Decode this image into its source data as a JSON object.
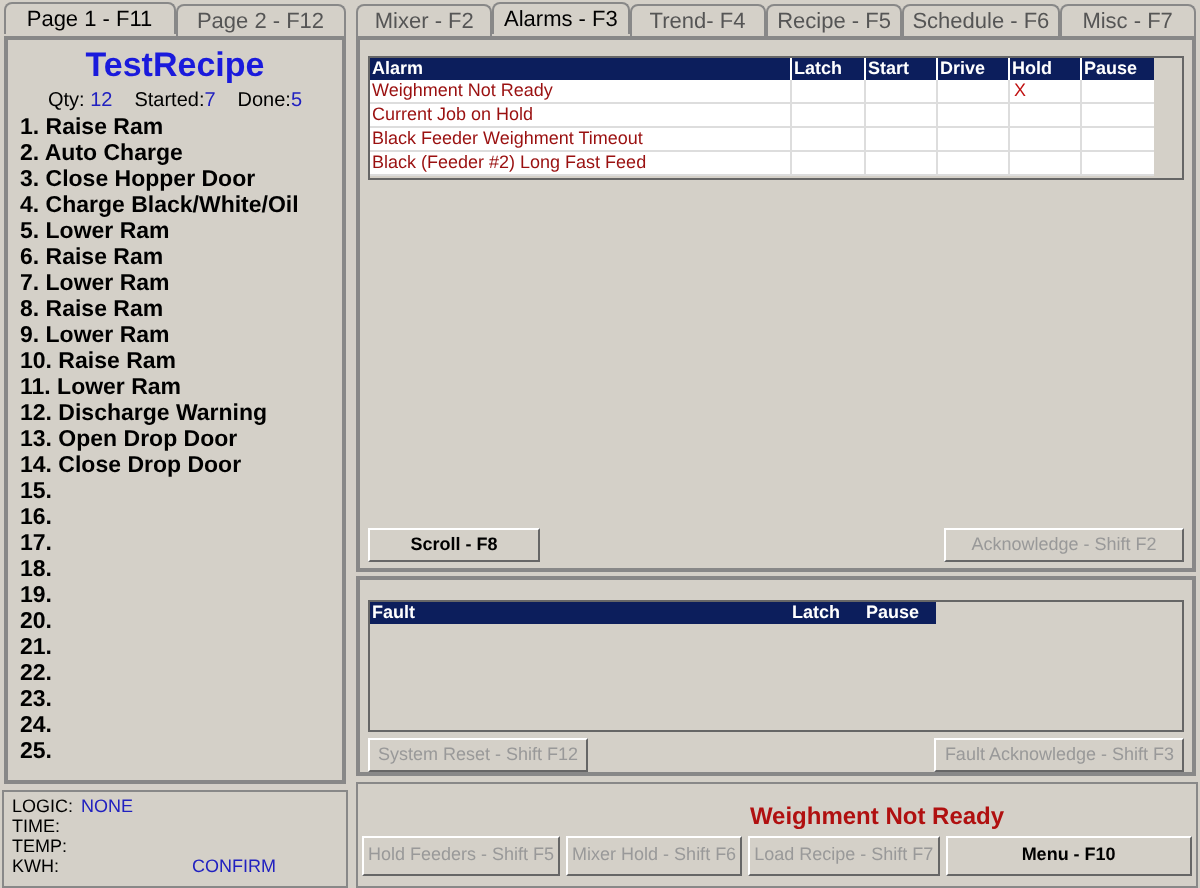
{
  "left_tabs": [
    {
      "label": "Page 1 - F11",
      "selected": true
    },
    {
      "label": "Page 2 - F12",
      "selected": false
    }
  ],
  "recipe": {
    "title": "TestRecipe",
    "qty_label": "Qty:",
    "qty": "12",
    "started_label": "Started:",
    "started": "7",
    "done_label": "Done:",
    "done": "5"
  },
  "steps": [
    "1. Raise Ram",
    "2. Auto Charge",
    "3. Close Hopper Door",
    "4. Charge Black/White/Oil",
    "5. Lower Ram",
    "6. Raise Ram",
    "7. Lower Ram",
    "8. Raise Ram",
    "9. Lower Ram",
    "10. Raise Ram",
    "11. Lower Ram",
    "12. Discharge Warning",
    "13. Open Drop Door",
    "14. Close Drop Door",
    "15.",
    "16.",
    "17.",
    "18.",
    "19.",
    "20.",
    "21.",
    "22.",
    "23.",
    "24.",
    "25."
  ],
  "status": {
    "logic_label": "LOGIC:",
    "logic": "NONE",
    "time_label": "TIME:",
    "temp_label": "TEMP:",
    "kwh_label": "KWH:",
    "confirm": "CONFIRM"
  },
  "right_tabs": [
    {
      "label": "Mixer - F2",
      "selected": false
    },
    {
      "label": "Alarms - F3",
      "selected": true
    },
    {
      "label": "Trend- F4",
      "selected": false
    },
    {
      "label": "Recipe - F5",
      "selected": false
    },
    {
      "label": "Schedule - F6",
      "selected": false
    },
    {
      "label": "Misc - F7",
      "selected": false
    }
  ],
  "alarm_table": {
    "columns": [
      "Alarm",
      "Latch",
      "Start",
      "Drive",
      "Hold",
      "Pause"
    ],
    "mark": "X",
    "rows": [
      {
        "alarm": "Weighment Not Ready",
        "flags": [
          false,
          false,
          false,
          true,
          false
        ]
      },
      {
        "alarm": "Current Job on Hold",
        "flags": [
          false,
          false,
          false,
          false,
          false
        ]
      },
      {
        "alarm": "Black Feeder Weighment Timeout",
        "flags": [
          false,
          false,
          false,
          false,
          false
        ]
      },
      {
        "alarm": "Black  (Feeder #2) Long Fast Feed",
        "flags": [
          false,
          false,
          false,
          false,
          false
        ]
      }
    ]
  },
  "alarm_buttons": [
    {
      "label": "Scroll - F8",
      "disabled": false
    },
    {
      "label": "Acknowledge - Shift F2",
      "disabled": true
    }
  ],
  "fault_table": {
    "columns": [
      "Fault",
      "Latch",
      "Pause"
    ]
  },
  "fault_buttons": [
    {
      "label": "System Reset - Shift F12",
      "disabled": true
    },
    {
      "label": "Fault Acknowledge - Shift F3",
      "disabled": true
    }
  ],
  "message": "Weighment Not Ready",
  "bottom_buttons": [
    {
      "label": "Hold Feeders - Shift F5",
      "disabled": true
    },
    {
      "label": "Mixer Hold -   Shift F6",
      "disabled": true
    },
    {
      "label": "Load Recipe - Shift F7",
      "disabled": true
    },
    {
      "label": "Menu - F10",
      "disabled": false
    }
  ]
}
